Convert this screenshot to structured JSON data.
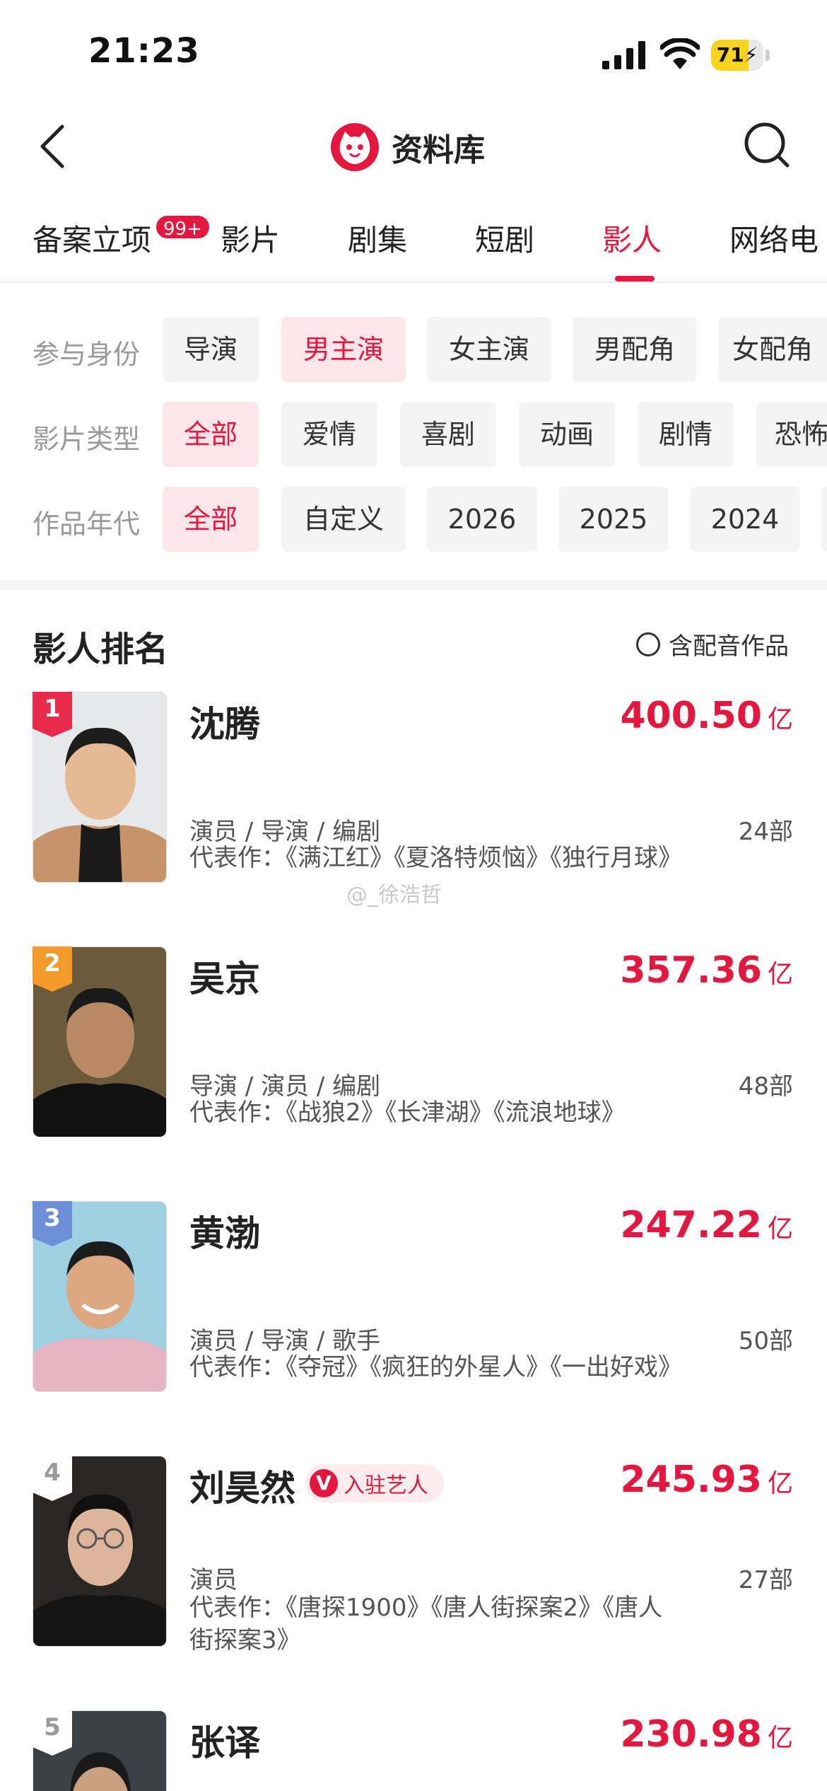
{
  "status_bar": {
    "time": "21:23",
    "battery_percent": 71,
    "battery_label": "71"
  },
  "nav": {
    "title": "资料库",
    "icons": [
      "back-chevron-icon",
      "maoyan-cat-logo",
      "search-icon"
    ]
  },
  "tabs": [
    {
      "label": "备案立项",
      "badge": "99+"
    },
    {
      "label": "影片"
    },
    {
      "label": "剧集"
    },
    {
      "label": "短剧"
    },
    {
      "label": "影人",
      "active": true
    },
    {
      "label": "网络电"
    }
  ],
  "filters": {
    "identity": {
      "label": "参与身份",
      "options": [
        "导演",
        "男主演",
        "女主演",
        "男配角",
        "女配角"
      ],
      "selected": "男主演"
    },
    "genre": {
      "label": "影片类型",
      "options": [
        "全部",
        "爱情",
        "喜剧",
        "动画",
        "剧情",
        "恐怖"
      ],
      "selected": "全部"
    },
    "year": {
      "label": "作品年代",
      "options": [
        "全部",
        "自定义",
        "2026",
        "2025",
        "2024"
      ],
      "selected": "全部"
    }
  },
  "ranking": {
    "title": "影人排名",
    "dub_toggle": "含配音作品",
    "items": [
      {
        "rank": "1",
        "name": "沈腾",
        "box_office": "400.50",
        "unit": "亿",
        "roles": "演员 / 导演 / 编剧",
        "works": "24部",
        "rep": "代表作：《满江红》《夏洛特烦恼》《独行月球》"
      },
      {
        "rank": "2",
        "name": "吴京",
        "box_office": "357.36",
        "unit": "亿",
        "roles": "导演 / 演员 / 编剧",
        "works": "48部",
        "rep": "代表作：《战狼2》《长津湖》《流浪地球》"
      },
      {
        "rank": "3",
        "name": "黄渤",
        "box_office": "247.22",
        "unit": "亿",
        "roles": "演员 / 导演 / 歌手",
        "works": "50部",
        "rep": "代表作：《夺冠》《疯狂的外星人》《一出好戏》"
      },
      {
        "rank": "4",
        "name": "刘昊然",
        "verified": "入驻艺人",
        "box_office": "245.93",
        "unit": "亿",
        "roles": "演员",
        "works": "27部",
        "rep": "代表作：《唐探1900》《唐人街探案2》《唐人街探案3》"
      },
      {
        "rank": "5",
        "name": "张译",
        "box_office": "230.98",
        "unit": "亿"
      }
    ]
  },
  "watermark": "@_徐浩哲",
  "colors": {
    "accent": "#e5173f",
    "rank1": "#ea2a4a",
    "rank2": "#f39a2b",
    "rank3": "#6d8fd8",
    "rank_other": "#9a9a9a"
  }
}
